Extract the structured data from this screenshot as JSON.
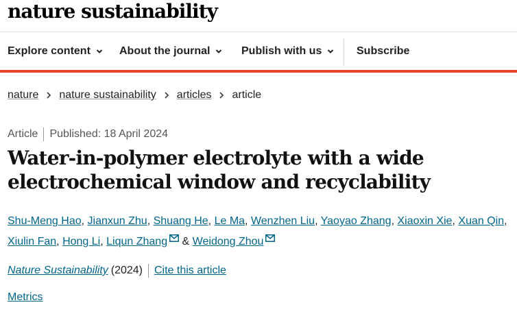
{
  "site": {
    "logo": "nature sustainability"
  },
  "nav": {
    "items": [
      {
        "label": "Explore content"
      },
      {
        "label": "About the journal"
      },
      {
        "label": "Publish with us"
      }
    ],
    "subscribe": "Subscribe"
  },
  "breadcrumb": [
    "nature",
    "nature sustainability",
    "articles",
    "article"
  ],
  "article": {
    "type": "Article",
    "published": "Published: 18 April 2024",
    "title": "Water-in-polymer electrolyte with a wide electrochemical window and recyclability",
    "authors": [
      "Shu-Meng Hao",
      "Jianxun Zhu",
      "Shuang He",
      "Le Ma",
      "Wenzhen Liu",
      "Yaoyao Zhang",
      "Xiaoxin Xie",
      "Xuan Qin",
      "Xiulin Fan",
      "Hong Li",
      "Liqun Zhang",
      "Weidong Zhou"
    ],
    "author_sep": ",",
    "author_and": "&",
    "journal": "Nature Sustainability",
    "year": "(2024)",
    "cite": "Cite this article",
    "metrics": "Metrics"
  },
  "colors": {
    "accent": "#e8412c",
    "link": "#00668a"
  },
  "icons": {
    "nav_dropdown": "chevron-down-icon",
    "crumb_sep": "chevron-right-icon",
    "email": "mail-icon"
  }
}
